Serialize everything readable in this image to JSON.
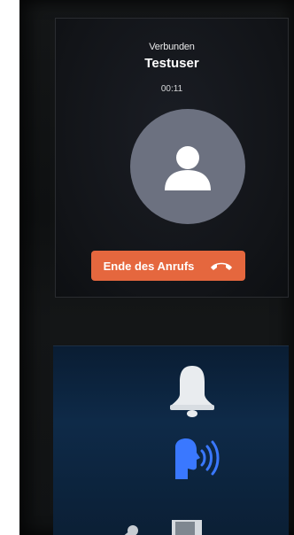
{
  "call": {
    "status": "Verbunden",
    "caller": "Testuser",
    "duration": "00:11"
  },
  "controls": {
    "end_call_label": "Ende des Anrufs"
  },
  "icons": {
    "avatar": "user-silhouette-icon",
    "hangup": "phone-hangup-icon",
    "bell": "bell-icon",
    "voice": "speaking-head-icon",
    "door": "door-icon",
    "key": "key-icon"
  },
  "colors": {
    "end_call_button": "#e5673e",
    "avatar_bg": "#6c7180",
    "voice_icon": "#2f6bff",
    "panel_bg": "#0e2a48"
  }
}
